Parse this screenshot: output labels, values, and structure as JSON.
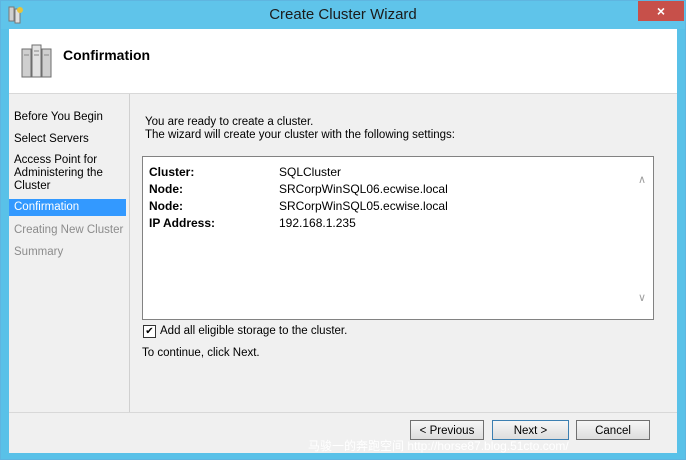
{
  "window": {
    "title": "Create Cluster Wizard",
    "close_glyph": "×"
  },
  "header": {
    "title": "Confirmation",
    "icon": "cluster-servers-icon"
  },
  "nav": {
    "items": [
      {
        "label": "Before You Begin",
        "state": "done"
      },
      {
        "label": "Select Servers",
        "state": "done"
      },
      {
        "label": "Access Point for Administering the Cluster",
        "state": "done"
      },
      {
        "label": "Confirmation",
        "state": "active"
      },
      {
        "label": "Creating New Cluster",
        "state": "disabled"
      },
      {
        "label": "Summary",
        "state": "disabled"
      }
    ]
  },
  "main": {
    "intro_line1": "You are ready to create a cluster.",
    "intro_line2": "The wizard will create your cluster with the following settings:",
    "settings": [
      {
        "key": "Cluster:",
        "value": "SQLCluster"
      },
      {
        "key": "Node:",
        "value": "SRCorpWinSQL06.ecwise.local"
      },
      {
        "key": "Node:",
        "value": "SRCorpWinSQL05.ecwise.local"
      },
      {
        "key": "IP Address:",
        "value": "192.168.1.235"
      }
    ],
    "add_storage_label": "Add all eligible storage to the cluster.",
    "add_storage_checked": true,
    "continue_text": "To continue, click Next."
  },
  "footer": {
    "previous": "< Previous",
    "next": "Next >",
    "cancel": "Cancel"
  },
  "watermark": "马骏一的奔跑空间 http://horse87.blog.51cto.com/",
  "colors": {
    "accent": "#3399ff",
    "titlebar": "#5fc4ea",
    "close": "#c7504a"
  }
}
